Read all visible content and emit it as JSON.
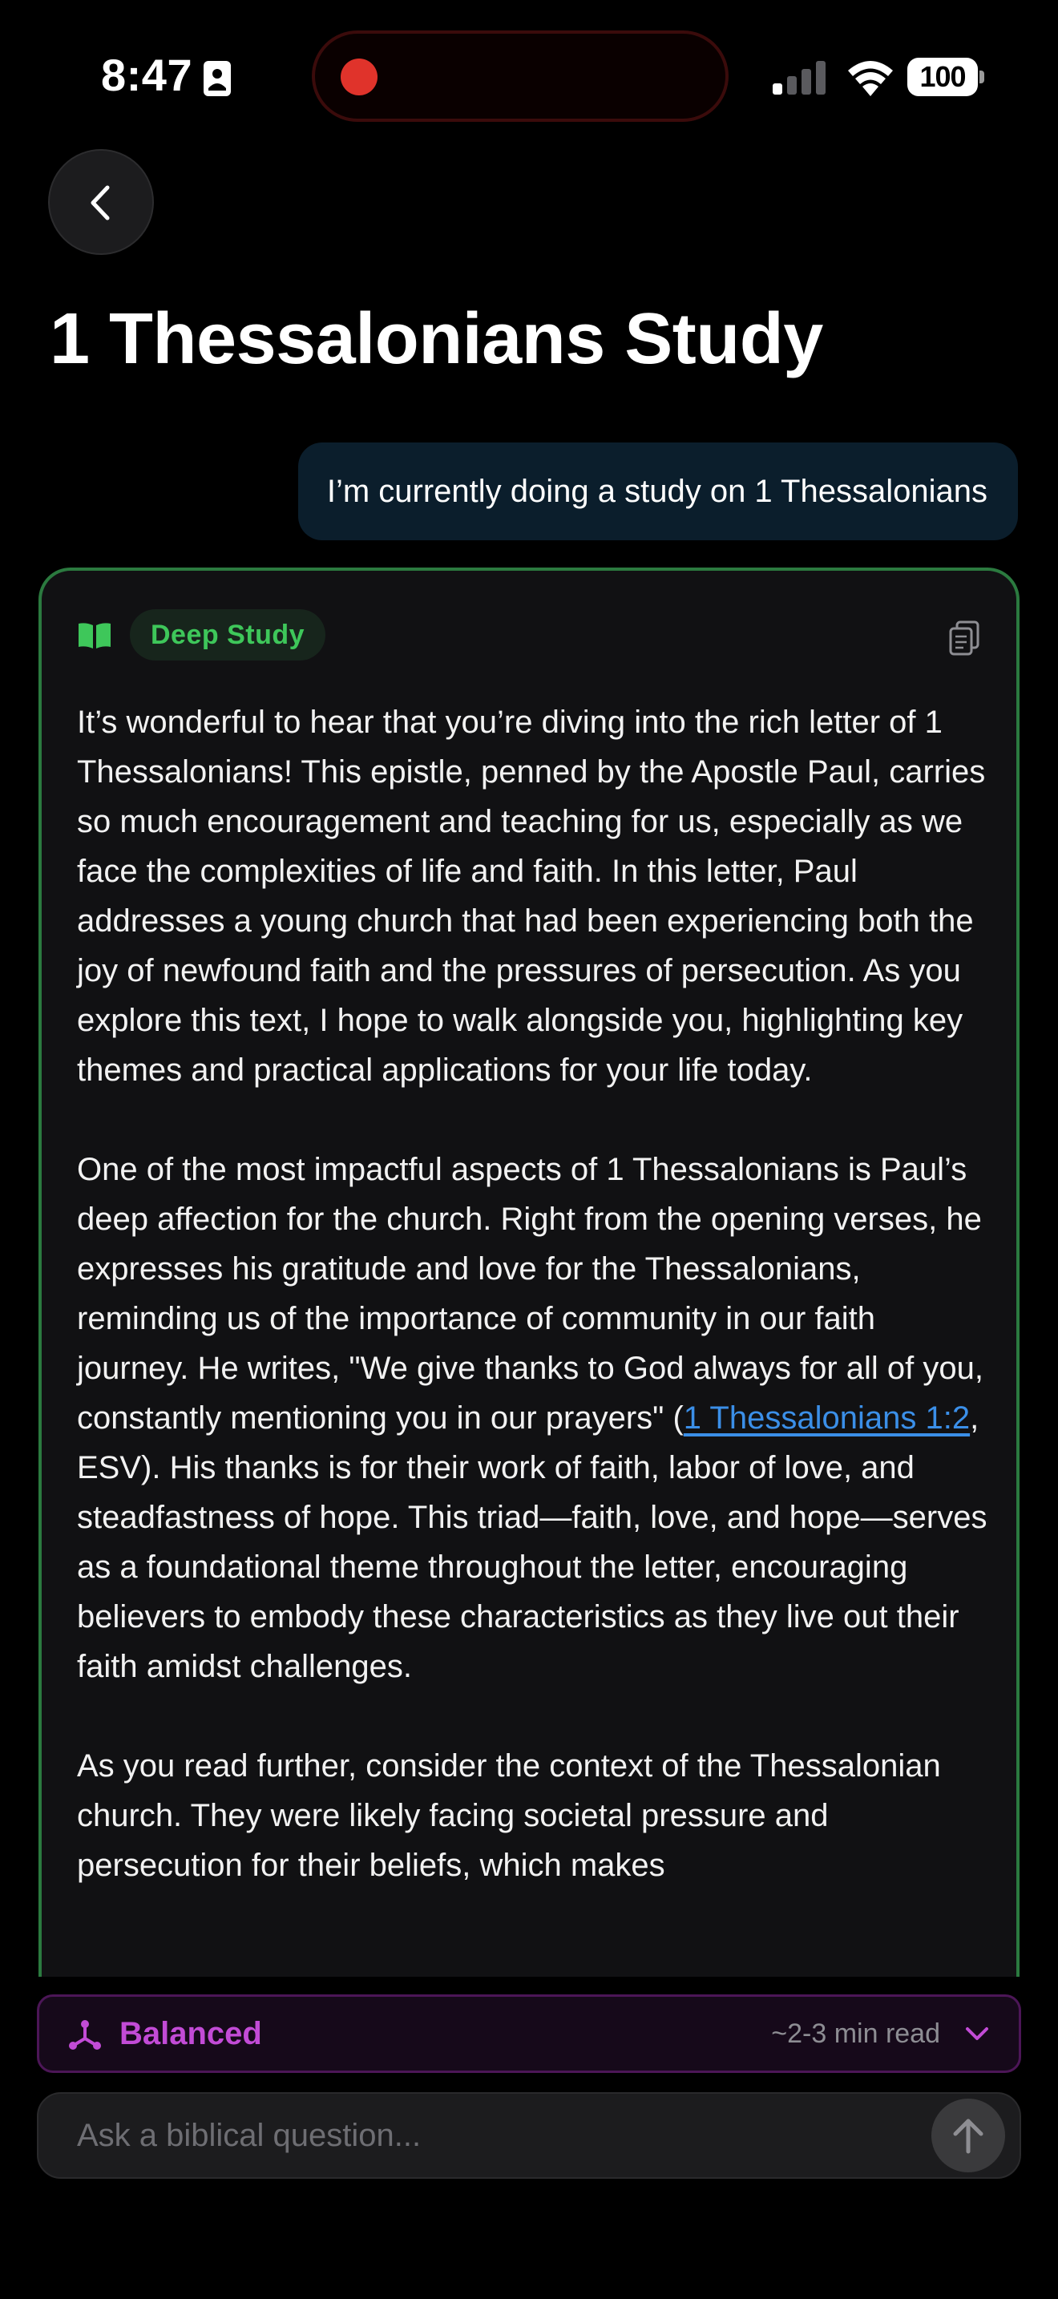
{
  "status_bar": {
    "time": "8:47",
    "battery": "100"
  },
  "header": {
    "title": "1 Thessalonians Study"
  },
  "conversation": {
    "user_message": "I’m currently doing a study on 1 Thessalonians",
    "response": {
      "mode_badge": "Deep Study",
      "accent_color": "#3ec75a",
      "paragraph_1": "It’s wonderful to hear that you’re diving into the rich letter of 1 Thessalonians! This epistle, penned by the Apostle Paul, carries so much encouragement and teaching for us, especially as we face the complexities of life and faith. In this letter, Paul addresses a young church that had been experiencing both the joy of newfound faith and the pressures of persecution. As you explore this text, I hope to walk alongside you, highlighting key themes and practical applications for your life today.",
      "paragraph_2_before": "One of the most impactful aspects of 1 Thessalonians is Paul’s deep affection for the church. Right from the opening verses, he expresses his gratitude and love for the Thessalonians, reminding us of the importance of community in our faith journey. He writes, \"We give thanks to God always for all of you, constantly mentioning you in our prayers\" (",
      "paragraph_2_link": "1 Thessalonians 1:2",
      "link_color": "#3b8fe8",
      "paragraph_2_after": ", ESV). His thanks is for their work of faith, labor of love, and steadfastness of hope. This triad—faith, love, and hope—serves as a foundational theme throughout the letter, encouraging believers to embody these characteristics as they live out their faith amidst challenges.",
      "paragraph_3": "As you read further, consider the context of the Thessalonian church. They were likely facing societal pressure and persecution for their beliefs, which makes"
    }
  },
  "mode_selector": {
    "label": "Balanced",
    "read_time": "~2-3 min read",
    "accent_color": "#c24bd6"
  },
  "ask_bar": {
    "placeholder": "Ask a biblical question...",
    "value": ""
  }
}
